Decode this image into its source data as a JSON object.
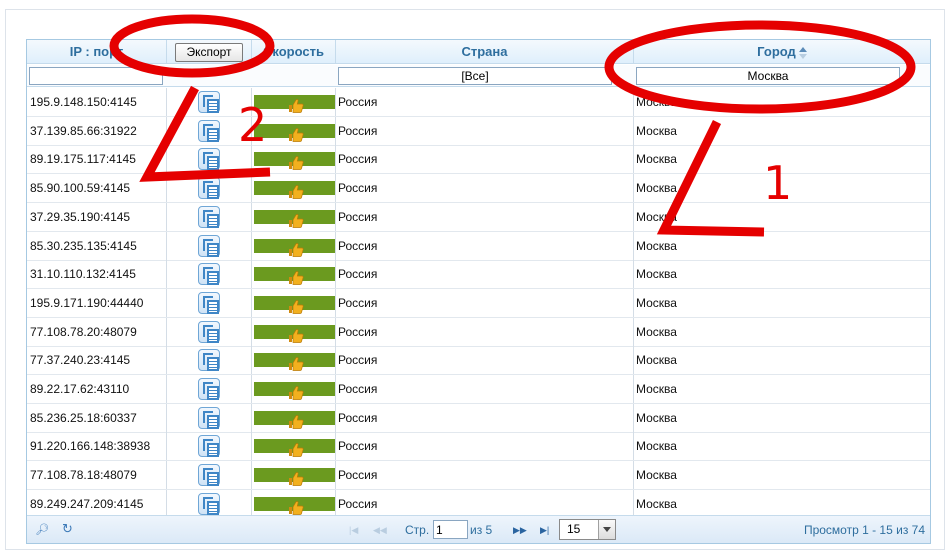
{
  "header": {
    "col_ip": "IP : порт",
    "col_speed": "Скорость",
    "col_country": "Страна",
    "col_city": "Город",
    "export_label": "Экспорт"
  },
  "filters": {
    "ip": "",
    "country": "[Все]",
    "city": "Москва"
  },
  "rows": [
    {
      "ip": "195.9.148.150:4145",
      "country": "Россия",
      "city": "Москва"
    },
    {
      "ip": "37.139.85.66:31922",
      "country": "Россия",
      "city": "Москва"
    },
    {
      "ip": "89.19.175.117:4145",
      "country": "Россия",
      "city": "Москва"
    },
    {
      "ip": "85.90.100.59:4145",
      "country": "Россия",
      "city": "Москва"
    },
    {
      "ip": "37.29.35.190:4145",
      "country": "Россия",
      "city": "Москва"
    },
    {
      "ip": "85.30.235.135:4145",
      "country": "Россия",
      "city": "Москва"
    },
    {
      "ip": "31.10.110.132:4145",
      "country": "Россия",
      "city": "Москва"
    },
    {
      "ip": "195.9.171.190:44440",
      "country": "Россия",
      "city": "Москва"
    },
    {
      "ip": "77.108.78.20:48079",
      "country": "Россия",
      "city": "Москва"
    },
    {
      "ip": "77.37.240.23:4145",
      "country": "Россия",
      "city": "Москва"
    },
    {
      "ip": "89.22.17.62:43110",
      "country": "Россия",
      "city": "Москва"
    },
    {
      "ip": "85.236.25.18:60337",
      "country": "Россия",
      "city": "Москва"
    },
    {
      "ip": "91.220.166.148:38938",
      "country": "Россия",
      "city": "Москва"
    },
    {
      "ip": "77.108.78.18:48079",
      "country": "Россия",
      "city": "Москва"
    },
    {
      "ip": "89.249.247.209:4145",
      "country": "Россия",
      "city": "Москва"
    }
  ],
  "pager": {
    "page_label": "Стр.",
    "page_value": "1",
    "of_label": "из 5",
    "page_size": "15",
    "summary": "Просмотр 1 - 15 из 74",
    "icons": [
      "search-icon",
      "refresh-icon",
      "first-page-icon",
      "prev-page-icon",
      "next-page-icon",
      "last-page-icon"
    ]
  },
  "annotations": {
    "label_1": "1",
    "label_2": "2",
    "color": "#e50000"
  },
  "colors": {
    "header_text": "#2e6e9e",
    "speed_bar": "#6b9a1f",
    "thumb": "#f2b01e"
  }
}
